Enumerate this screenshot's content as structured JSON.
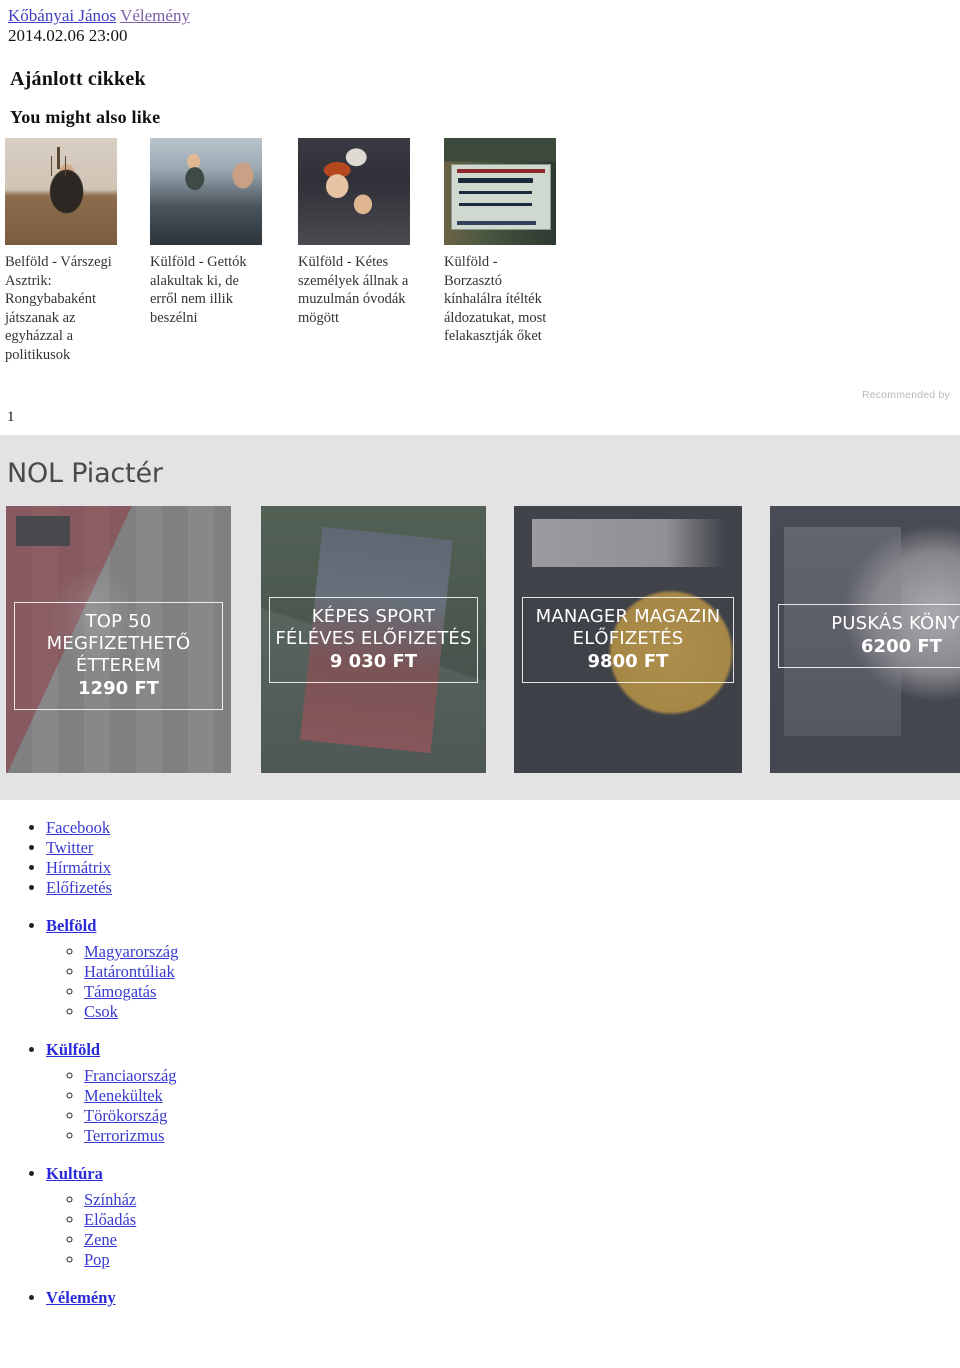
{
  "header": {
    "author": "Kőbányai János",
    "section": "Vélemény",
    "date": "2014.02.06 23:00",
    "recommended_heading": "Ajánlott cikkek",
    "ymal_heading": "You might also like"
  },
  "recommendations": {
    "page_number": "1",
    "recommended_by": "Recommended by",
    "items": [
      {
        "title": "Belföld - Várszegi Asztrik: Rongybabaként játszanak az egyházzal a politikusok",
        "image": "priest-portrait-photo"
      },
      {
        "title": "Külföld - Gettók alakultak ki, de erről nem illik beszélni",
        "image": "crowd-street-photo"
      },
      {
        "title": "Külföld - Kétes személyek állnak a muzulmán óvodák mögött",
        "image": "children-crowd-photo"
      },
      {
        "title": "Külföld - Borzasztó kínhalálra ítélték áldozatukat, most felakasztják őket",
        "image": "protest-sign-photo"
      }
    ]
  },
  "marketplace": {
    "title": "NOL Piactér",
    "cards": [
      {
        "name": "TOP 50 MEGFIZETHETŐ ÉTTEREM",
        "price": "1290 FT",
        "image": "top50-restaurant-guide-cover"
      },
      {
        "name": "KÉPES SPORT FÉLÉVES ELŐFIZETÉS",
        "price": "9 030 FT",
        "image": "kepes-sport-magazine-cover"
      },
      {
        "name": "MANAGER MAGAZIN ELŐFIZETÉS",
        "price": "9800 FT",
        "image": "manager-magazin-cover"
      },
      {
        "name": "PUSKÁS KÖNYV",
        "price": "6200 FT",
        "image": "puskas-book-cover"
      }
    ]
  },
  "footer": {
    "social_links": [
      "Facebook",
      "Twitter",
      "Hírmátrix",
      "Előfizetés"
    ],
    "categories": [
      {
        "label": "Belföld",
        "items": [
          "Magyarország",
          "Határontúliak",
          "Támogatás",
          "Csok"
        ]
      },
      {
        "label": "Külföld",
        "items": [
          "Franciaország",
          "Menekültek",
          "Törökország",
          "Terrorizmus"
        ]
      },
      {
        "label": "Kultúra",
        "items": [
          "Színház",
          "Előadás",
          "Zene",
          "Pop"
        ]
      },
      {
        "label": "Vélemény",
        "items": []
      }
    ]
  },
  "colors": {
    "link": "#3a3ad0",
    "author_link": "#3f3fbf",
    "section_link": "#7a5fa8",
    "marketplace_bg": "#e3e3e3",
    "marketplace_title": "#4a4a4a",
    "recommended_by": "#b9b9b9"
  }
}
